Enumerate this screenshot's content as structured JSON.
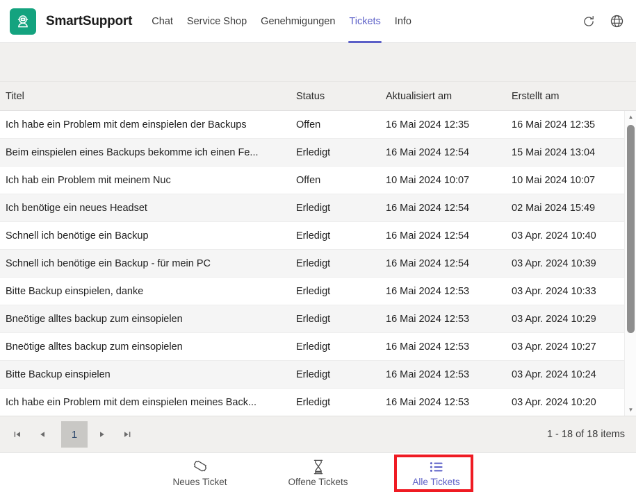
{
  "app": {
    "brand": "SmartSupport",
    "logo_icon": "robot-support-icon",
    "accent_color": "#5b5fc7",
    "logo_bg_color": "#14a37f",
    "highlight_color": "#ef1b23"
  },
  "nav": {
    "tabs": [
      {
        "label": "Chat",
        "active": false
      },
      {
        "label": "Service Shop",
        "active": false
      },
      {
        "label": "Genehmigungen",
        "active": false
      },
      {
        "label": "Tickets",
        "active": true
      },
      {
        "label": "Info",
        "active": false
      }
    ],
    "actions": [
      {
        "name": "refresh-icon",
        "label": "Refresh"
      },
      {
        "name": "globe-icon",
        "label": "Language"
      }
    ]
  },
  "grid": {
    "columns": [
      {
        "key": "title",
        "label": "Titel"
      },
      {
        "key": "status",
        "label": "Status"
      },
      {
        "key": "updated",
        "label": "Aktualisiert am"
      },
      {
        "key": "created",
        "label": "Erstellt am"
      }
    ],
    "rows": [
      {
        "title": "Ich habe ein Problem mit dem einspielen der Backups",
        "status": "Offen",
        "updated": "16 Mai 2024 12:35",
        "created": "16 Mai 2024 12:35"
      },
      {
        "title": "Beim einspielen eines Backups bekomme ich einen Fe...",
        "status": "Erledigt",
        "updated": "16 Mai 2024 12:54",
        "created": "15 Mai 2024 13:04"
      },
      {
        "title": "Ich hab ein Problem mit meinem Nuc",
        "status": "Offen",
        "updated": "10 Mai 2024 10:07",
        "created": "10 Mai 2024 10:07"
      },
      {
        "title": "Ich benötige ein neues Headset",
        "status": "Erledigt",
        "updated": "16 Mai 2024 12:54",
        "created": "02 Mai 2024 15:49"
      },
      {
        "title": "Schnell ich benötige ein Backup",
        "status": "Erledigt",
        "updated": "16 Mai 2024 12:54",
        "created": "03 Apr. 2024 10:40"
      },
      {
        "title": "Schnell ich benötige ein Backup - für mein PC",
        "status": "Erledigt",
        "updated": "16 Mai 2024 12:54",
        "created": "03 Apr. 2024 10:39"
      },
      {
        "title": "Bitte Backup einspielen, danke",
        "status": "Erledigt",
        "updated": "16 Mai 2024 12:53",
        "created": "03 Apr. 2024 10:33"
      },
      {
        "title": "Bneötige alltes backup zum einsopielen",
        "status": "Erledigt",
        "updated": "16 Mai 2024 12:53",
        "created": "03 Apr. 2024 10:29"
      },
      {
        "title": "Bneötige alltes backup zum einsopielen",
        "status": "Erledigt",
        "updated": "16 Mai 2024 12:53",
        "created": "03 Apr. 2024 10:27"
      },
      {
        "title": "Bitte Backup einspielen",
        "status": "Erledigt",
        "updated": "16 Mai 2024 12:53",
        "created": "03 Apr. 2024 10:24"
      },
      {
        "title": "Ich habe ein Problem mit dem einspielen meines Back...",
        "status": "Erledigt",
        "updated": "16 Mai 2024 12:53",
        "created": "03 Apr. 2024 10:20"
      }
    ]
  },
  "pager": {
    "first_label": "❙◂",
    "prev_label": "◂",
    "current_page": "1",
    "next_label": "▸",
    "last_label": "▸❙",
    "info": "1 - 18 of 18 items"
  },
  "bottom_nav": {
    "items": [
      {
        "label": "Neues Ticket",
        "icon": "ticket-icon",
        "active": false
      },
      {
        "label": "Offene Tickets",
        "icon": "hourglass-icon",
        "active": false
      },
      {
        "label": "Alle Tickets",
        "icon": "list-icon",
        "active": true
      }
    ]
  }
}
